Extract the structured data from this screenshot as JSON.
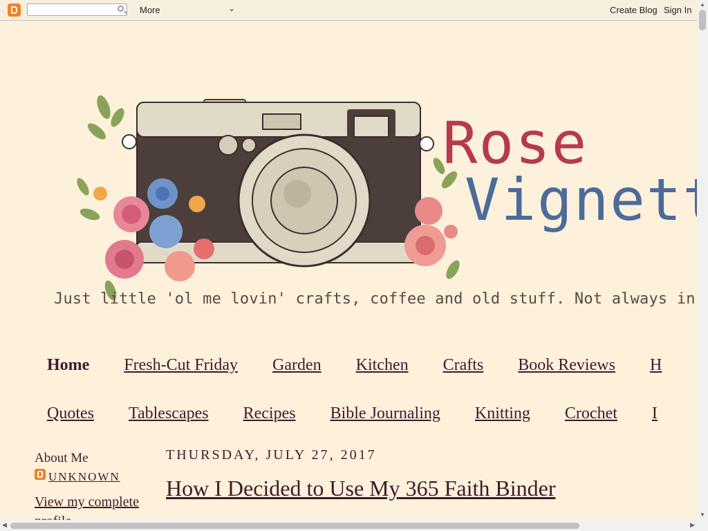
{
  "navbar": {
    "more_label": "More",
    "create_blog": "Create Blog",
    "sign_in": "Sign In",
    "search_placeholder": ""
  },
  "header": {
    "title_line1": "Rose",
    "title_line2": "Vignett",
    "tagline": "Just little 'ol me lovin' crafts, coffee and old stuff. Not always in that"
  },
  "tabs_row1": [
    "Home",
    "Fresh-Cut Friday",
    "Garden",
    "Kitchen",
    "Crafts",
    "Book Reviews",
    "H"
  ],
  "tabs_row2": [
    "Quotes",
    "Tablescapes",
    "Recipes",
    "Bible Journaling",
    "Knitting",
    "Crochet",
    "I"
  ],
  "sidebar": {
    "heading": "About Me",
    "profile_name": "UNKNOWN",
    "profile_link": "View my complete profile"
  },
  "post": {
    "date": "Thursday, July 27, 2017",
    "title": "How I Decided to Use My 365 Faith Binder"
  },
  "colors": {
    "background": "#fdf1db",
    "title_rose": "#b63a4c",
    "title_vignette": "#4d6b9a",
    "link": "#3e1a2a",
    "blogger_orange": "#f48026"
  }
}
